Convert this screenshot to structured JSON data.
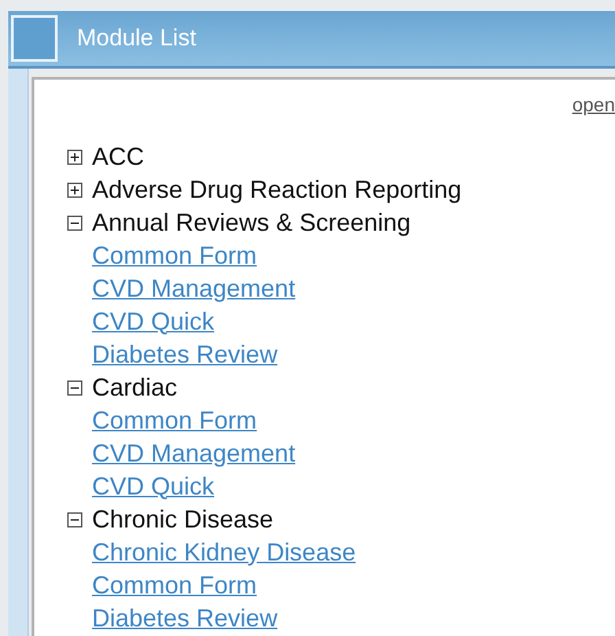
{
  "window": {
    "title": "Module List"
  },
  "open_link": "open",
  "tree": [
    {
      "label": "ACC",
      "expanded": false
    },
    {
      "label": "Adverse Drug Reaction Reporting",
      "expanded": false
    },
    {
      "label": "Annual Reviews & Screening",
      "expanded": true,
      "children": [
        {
          "label": "Common Form"
        },
        {
          "label": "CVD Management"
        },
        {
          "label": "CVD Quick"
        },
        {
          "label": "Diabetes Review"
        }
      ]
    },
    {
      "label": "Cardiac",
      "expanded": true,
      "children": [
        {
          "label": "Common Form"
        },
        {
          "label": "CVD Management"
        },
        {
          "label": "CVD Quick"
        }
      ]
    },
    {
      "label": "Chronic Disease",
      "expanded": true,
      "children": [
        {
          "label": "Chronic Kidney Disease"
        },
        {
          "label": "Common Form"
        },
        {
          "label": "Diabetes Review"
        }
      ]
    }
  ]
}
